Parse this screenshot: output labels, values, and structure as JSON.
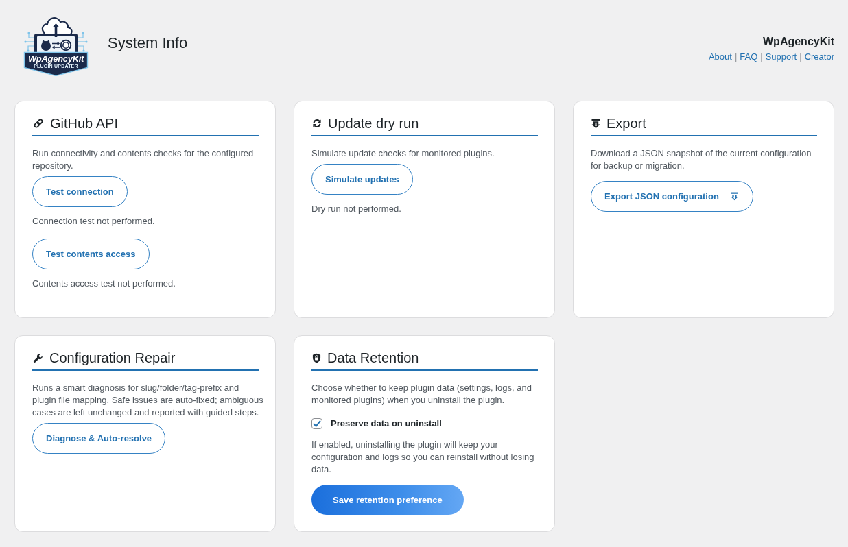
{
  "header": {
    "logo": {
      "wordmark": "WpAgencyKit",
      "tagline": "PLUGIN UPDATER"
    },
    "title": "System Info",
    "brand": "WpAgencyKit",
    "links": [
      {
        "kind": "link",
        "text": "About"
      },
      {
        "kind": "separator",
        "text": "|"
      },
      {
        "kind": "link",
        "text": "FAQ"
      },
      {
        "kind": "separator",
        "text": "|"
      },
      {
        "kind": "link",
        "text": "Support"
      },
      {
        "kind": "separator",
        "text": "|"
      },
      {
        "kind": "link",
        "text": "Creator"
      }
    ]
  },
  "cards": [
    {
      "kind": "github",
      "title": "GitHub API",
      "blocks": [
        {
          "kind": "description",
          "text": "Run connectivity and contents checks for the configured repository."
        },
        {
          "kind": "button",
          "label": "Test connection"
        },
        {
          "kind": "status",
          "text": "Connection test not performed."
        },
        {
          "kind": "button",
          "label": "Test contents access"
        },
        {
          "kind": "status",
          "text": "Contents access test not performed."
        }
      ]
    },
    {
      "kind": "dry-run",
      "title": "Update dry run",
      "blocks": [
        {
          "kind": "description",
          "text": "Simulate update checks for monitored plugins."
        },
        {
          "kind": "button",
          "label": "Simulate updates"
        },
        {
          "kind": "status",
          "text": "Dry run not performed."
        }
      ]
    },
    {
      "kind": "export",
      "title": "Export",
      "blocks": [
        {
          "kind": "description",
          "text": "Download a JSON snapshot of the current configuration for backup or migration."
        },
        {
          "kind": "download-button",
          "label": "Export JSON configuration"
        }
      ]
    },
    {
      "kind": "repair",
      "title": "Configuration Repair",
      "blocks": [
        {
          "kind": "description",
          "text": "Runs a smart diagnosis for slug/folder/tag-prefix and plugin file mapping. Safe issues are auto-fixed; ambiguous cases are left unchanged and reported with guided steps."
        },
        {
          "kind": "button",
          "label": "Diagnose & Auto-resolve"
        }
      ]
    },
    {
      "kind": "retention",
      "title": "Data Retention",
      "blocks": [
        {
          "kind": "description",
          "text": "Choose whether to keep plugin data (settings, logs, and monitored plugins) when you uninstall the plugin."
        },
        {
          "kind": "checkbox",
          "label": "Preserve data on uninstall",
          "checked": true
        },
        {
          "kind": "help",
          "text": "If enabled, uninstalling the plugin will keep your configuration and logs so you can reinstall without losing data."
        },
        {
          "kind": "primary-button",
          "label": "Save retention preference"
        }
      ]
    }
  ]
}
